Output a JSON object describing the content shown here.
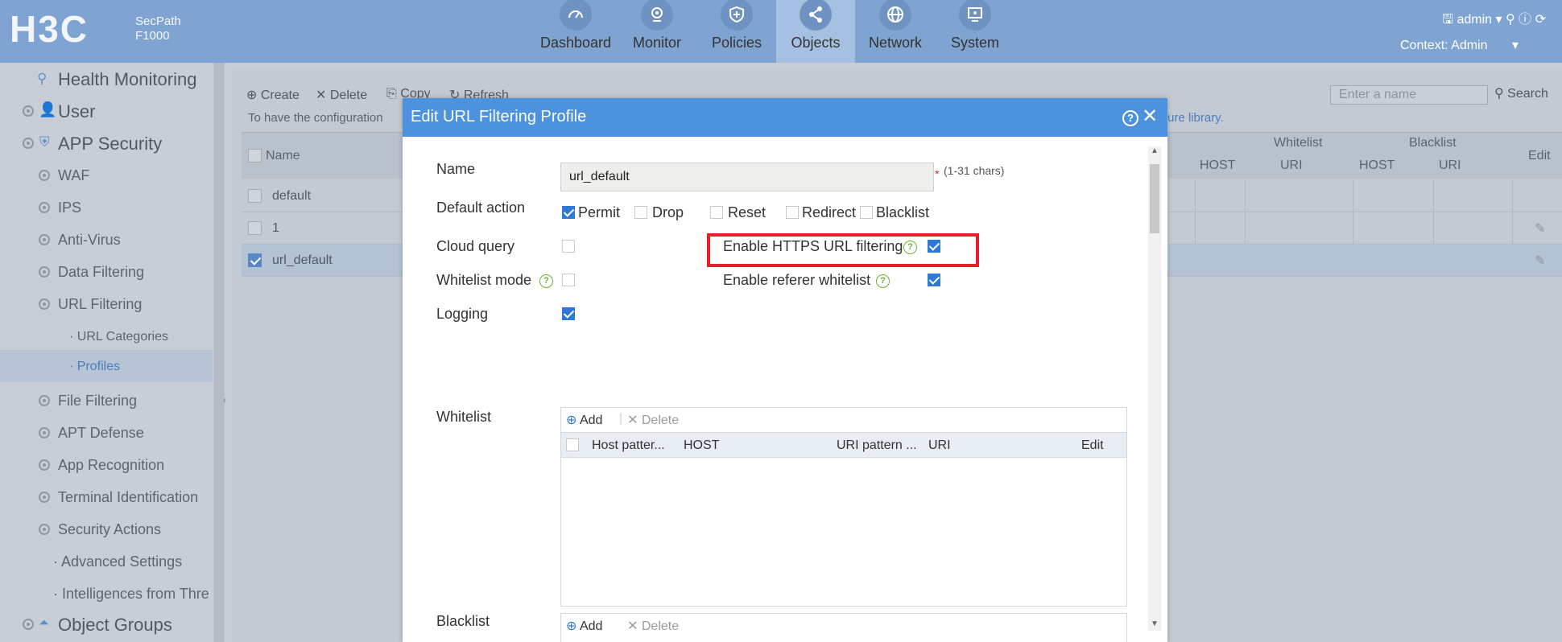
{
  "brand": {
    "logo_text": "H3C",
    "product_line1": "SecPath",
    "product_line2": "F1000"
  },
  "nav": [
    {
      "label": "Dashboard",
      "icon": "dashboard-icon",
      "active": false
    },
    {
      "label": "Monitor",
      "icon": "monitor-icon",
      "active": false
    },
    {
      "label": "Policies",
      "icon": "shield-icon",
      "active": false
    },
    {
      "label": "Objects",
      "icon": "share-icon",
      "active": true
    },
    {
      "label": "Network",
      "icon": "globe-icon",
      "active": false
    },
    {
      "label": "System",
      "icon": "screen-icon",
      "active": false
    }
  ],
  "user": {
    "name": "admin",
    "context_label": "Context: Admin"
  },
  "sidebar": {
    "items": [
      {
        "label": "Health Monitoring"
      },
      {
        "label": "User"
      },
      {
        "label": "APP Security"
      },
      {
        "label": "WAF"
      },
      {
        "label": "IPS"
      },
      {
        "label": "Anti-Virus"
      },
      {
        "label": "Data Filtering"
      },
      {
        "label": "URL Filtering"
      },
      {
        "label": "· URL Categories"
      },
      {
        "label": "· Profiles"
      },
      {
        "label": "File Filtering"
      },
      {
        "label": "APT Defense"
      },
      {
        "label": "App Recognition"
      },
      {
        "label": "Terminal Identification"
      },
      {
        "label": "Security Actions"
      },
      {
        "label": "· Advanced Settings"
      },
      {
        "label": "· Intelligences from Thre"
      },
      {
        "label": "Object Groups"
      }
    ]
  },
  "page": {
    "toolbar": {
      "create": "Create",
      "delete": "Delete",
      "copy": "Copy",
      "refresh": "Refresh"
    },
    "hint": "To have the configuration",
    "hint_link": "ure library.",
    "search_placeholder": "Enter a name",
    "search_button": "Search",
    "columns": {
      "name": "Name",
      "whitelist": "Whitelist",
      "blacklist": "Blacklist",
      "host": "HOST",
      "uri": "URI",
      "edit": "Edit"
    },
    "rows": [
      {
        "name": "default",
        "checked": false
      },
      {
        "name": "1",
        "checked": false
      },
      {
        "name": "url_default",
        "checked": true
      }
    ]
  },
  "dialog": {
    "title": "Edit URL Filtering Profile",
    "fields": {
      "name_label": "Name",
      "name_value": "url_default",
      "name_required": "*",
      "name_hint": "(1-31 chars)",
      "default_action_label": "Default action",
      "actions": [
        {
          "label": "Permit",
          "checked": true
        },
        {
          "label": "Drop",
          "checked": false
        },
        {
          "label": "Reset",
          "checked": false
        },
        {
          "label": "Redirect",
          "checked": false
        },
        {
          "label": "Blacklist",
          "checked": false
        }
      ],
      "cloud_query_label": "Cloud query",
      "cloud_query_checked": false,
      "https_label": "Enable HTTPS URL filtering",
      "https_checked": true,
      "whitelist_mode_label": "Whitelist mode",
      "whitelist_mode_checked": false,
      "referer_label": "Enable referer whitelist",
      "referer_checked": true,
      "logging_label": "Logging",
      "logging_checked": true
    },
    "whitelist": {
      "label": "Whitelist",
      "add": "Add",
      "delete": "Delete",
      "columns": {
        "host_pattern": "Host patter...",
        "host": "HOST",
        "uri_pattern": "URI pattern ...",
        "uri": "URI",
        "edit": "Edit"
      }
    },
    "blacklist": {
      "label": "Blacklist",
      "add": "Add",
      "delete": "Delete"
    }
  },
  "colors": {
    "accent": "#4d92df",
    "highlight": "#e5202a",
    "check": "#2f79d6",
    "help": "#6bb32e"
  }
}
